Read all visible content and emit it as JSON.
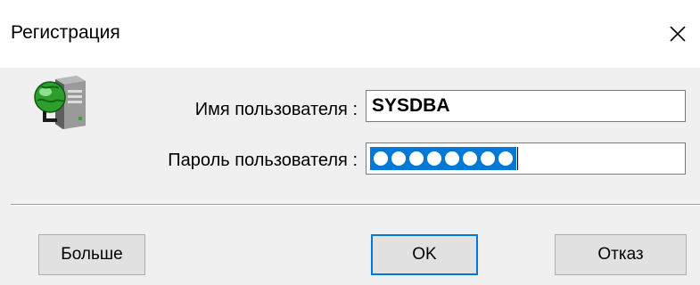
{
  "window": {
    "title": "Регистрация",
    "close_icon": "close-icon"
  },
  "icons": {
    "server": "server-globe-icon"
  },
  "form": {
    "username_label": "Имя пользователя :",
    "username_value": "SYSDBA",
    "password_label": "Пароль пользователя :",
    "password_masked_count": 8,
    "password_selected": true
  },
  "buttons": {
    "more_label": "Больше",
    "ok_label": "OK",
    "cancel_label": "Отказ"
  },
  "colors": {
    "accent": "#0078d7",
    "background": "#f0f0f0",
    "title_background": "#ffffff",
    "button_face": "#e1e1e1"
  }
}
